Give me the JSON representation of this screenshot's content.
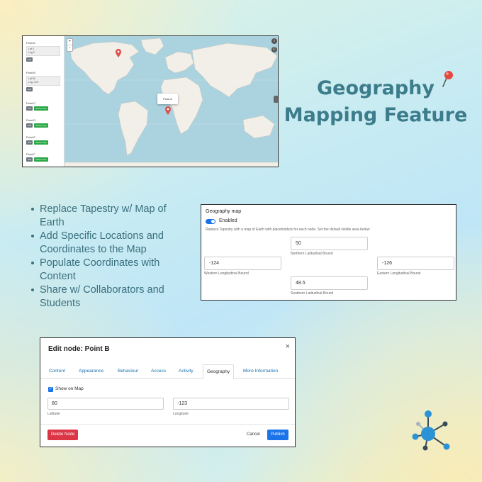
{
  "title": {
    "line1": "Geography",
    "line2": "Mapping Feature"
  },
  "map_screenshot": {
    "zoom_in": "+",
    "zoom_out": "-",
    "popup": "Point A",
    "side_buttons": [
      "i",
      "C"
    ],
    "points": [
      {
        "name": "Point A",
        "lat_label": "Lat",
        "lat": "0",
        "lng_label": "Lng",
        "lng": "0",
        "edit": "Edit"
      },
      {
        "name": "Point B",
        "lat_label": "Lat",
        "lat": "80",
        "lng_label": "Lng",
        "lng": "-123",
        "edit": "Edit"
      },
      {
        "name": "Point C",
        "edit": "Edit",
        "add": "Add to map"
      },
      {
        "name": "Point D",
        "edit": "Edit",
        "add": "Add to map"
      },
      {
        "name": "Point E",
        "edit": "Edit",
        "add": "Add to map"
      },
      {
        "name": "Point F",
        "edit": "Edit",
        "add": "Add to map"
      }
    ]
  },
  "bullets": [
    "Replace Tapestry w/ Map of Earth",
    "Add Specific Locations and Coordinates to the Map",
    "Populate Coordinates with Content",
    "Share w/ Collaborators and Students"
  ],
  "geography_panel": {
    "heading": "Geography map",
    "toggle_label": "Enabled",
    "description": "Replace Tapestry with a map of Earth with placeholders for each node. Set the default visible area below:",
    "north": {
      "value": "50",
      "label": "Northern Latitudinal Bound"
    },
    "west": {
      "value": "-124",
      "label": "Western Longitudinal Bound"
    },
    "east": {
      "value": "-126",
      "label": "Eastern Longitudinal Bound"
    },
    "south": {
      "value": "48.5",
      "label": "Southern Latitudinal Bound"
    }
  },
  "dialog": {
    "title": "Edit node: Point B",
    "close": "×",
    "tabs": [
      "Content",
      "Appearance",
      "Behaviour",
      "Access",
      "Activity",
      "Geography",
      "More Information"
    ],
    "active_tab": "Geography",
    "show_on_map": "Show on Map",
    "latitude": {
      "value": "80",
      "label": "Latitude"
    },
    "longitude": {
      "value": "-123",
      "label": "Longitude"
    },
    "delete": "Delete Node",
    "cancel": "Cancel",
    "publish": "Publish"
  },
  "colors": {
    "title": "#3c7c8b",
    "bullet_text": "#3a6f7e",
    "accent_blue": "#1a73e8",
    "danger": "#dc3545",
    "success": "#28a745",
    "ocean": "#aad3df",
    "land": "#f2efe9"
  },
  "icons": {
    "pin": "pushpin-icon",
    "logo": "network-node-logo",
    "close": "close-icon",
    "checkbox": "checkbox-checked-icon"
  }
}
